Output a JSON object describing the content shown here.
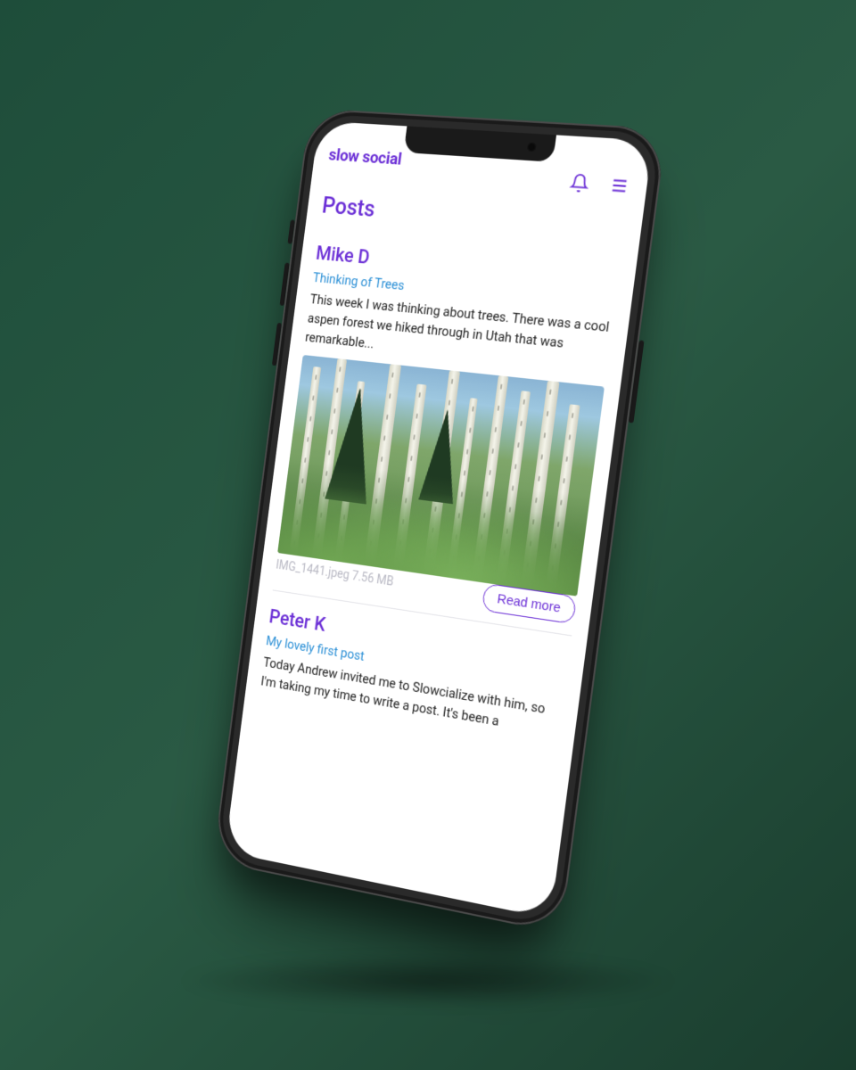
{
  "brand": "slow social",
  "page_title": "Posts",
  "icons": {
    "bell": "bell-icon",
    "menu": "menu-icon"
  },
  "posts": [
    {
      "author": "Mike D",
      "title": "Thinking of Trees",
      "body": "This week I was thinking about trees. There was a cool aspen forest we hiked through in Utah that was remarkable...",
      "image_meta": "IMG_1441.jpeg 7.56 MB",
      "read_more_label": "Read more"
    },
    {
      "author": "Peter K",
      "title": "My lovely first post",
      "body": "Today Andrew invited me to Slowcialize with him, so I'm taking my time to write a post. It's been a"
    }
  ],
  "colors": {
    "accent": "#6b2fd6",
    "link": "#2a8fd6"
  }
}
